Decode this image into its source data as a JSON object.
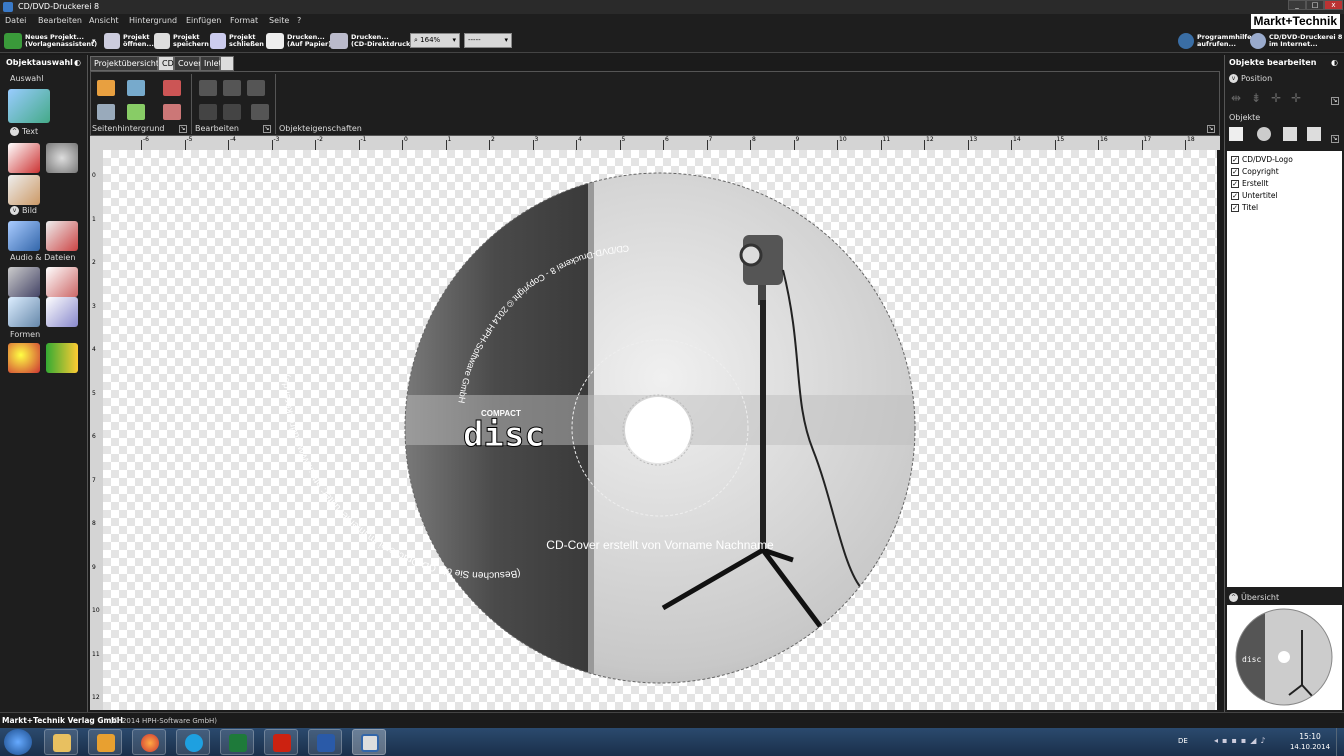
{
  "window": {
    "title": "CD/DVD-Druckerei 8",
    "controls": [
      "_",
      "□",
      "x"
    ]
  },
  "menu": [
    "Datei",
    "Bearbeiten",
    "Ansicht",
    "Hintergrund",
    "Einfügen",
    "Format",
    "Seite",
    "?"
  ],
  "brand": "Markt+Technik",
  "toolbar": {
    "new_project": [
      "Neues Projekt...",
      "(Vorlagenassistent)"
    ],
    "open_project": [
      "Projekt",
      "öffnen..."
    ],
    "save_project": [
      "Projekt",
      "speichern"
    ],
    "close_project": [
      "Projekt",
      "schließen"
    ],
    "print_paper": [
      "Drucken...",
      "(Auf Papier)"
    ],
    "print_cd": [
      "Drucken...",
      "(CD-Direktdruck)"
    ],
    "zoom": "164%",
    "line_style": "-----",
    "help": [
      "Programmhilfe",
      "aufrufen..."
    ],
    "internet": [
      "CD/DVD-Druckerei 8",
      "im Internet..."
    ]
  },
  "left_panel": {
    "title": "Objektauswahl",
    "sections": {
      "auswahl": "Auswahl",
      "text": "Text",
      "bild": "Bild",
      "audio": "Audio & Dateien",
      "formen": "Formen"
    }
  },
  "tabs": [
    "Projektübersicht",
    "CD",
    "Cover",
    "Inlet"
  ],
  "ribbon": {
    "groups": [
      "Seitenhintergrund",
      "Bearbeiten",
      "Objekteigenschaften"
    ]
  },
  "ruler": {
    "h": [
      "-6",
      "-5",
      "-4",
      "-3",
      "-2",
      "-1",
      "0",
      "1",
      "2",
      "3",
      "4",
      "5",
      "6",
      "7",
      "8",
      "9",
      "10",
      "11",
      "12",
      "13",
      "14",
      "15",
      "16",
      "17",
      "18"
    ],
    "v": [
      "0",
      "1",
      "2",
      "3",
      "4",
      "5",
      "6",
      "7",
      "8",
      "9",
      "10",
      "11",
      "12"
    ]
  },
  "disc": {
    "copyright_arc": "CD/DVD-Druckerei 8 - Copyright © 2014 HPH-Software GmbH",
    "website_arc": "(Besuchen Sie die CD-Druckerei im Internet unter: http://www.cddruckerei.de)",
    "logo_top": "COMPACT",
    "logo_main": "disc",
    "subtitle": "CD-Cover erstellt von Vorname Nachname"
  },
  "right_panel": {
    "title": "Objekte bearbeiten",
    "position": "Position",
    "objects_label": "Objekte",
    "objects": [
      "CD/DVD-Logo",
      "Copyright",
      "Erstellt",
      "Untertitel",
      "Titel"
    ],
    "overview": "Übersicht",
    "overview_logo": "disc"
  },
  "status": {
    "company": "Markt+Technik Verlag GmbH",
    "copyright": "(© 2014 HPH-Software GmbH)"
  },
  "taskbar": {
    "lang": "DE",
    "time": "15:10",
    "date": "14.10.2014",
    "apps": [
      "explorer",
      "outlook",
      "firefox",
      "skype",
      "excel",
      "acrobat",
      "word",
      "cd-druckerei"
    ]
  },
  "colors": {
    "panel": "#1e1e1e",
    "ruler": "#d4d4d4",
    "accent": "#3a6ea5"
  }
}
